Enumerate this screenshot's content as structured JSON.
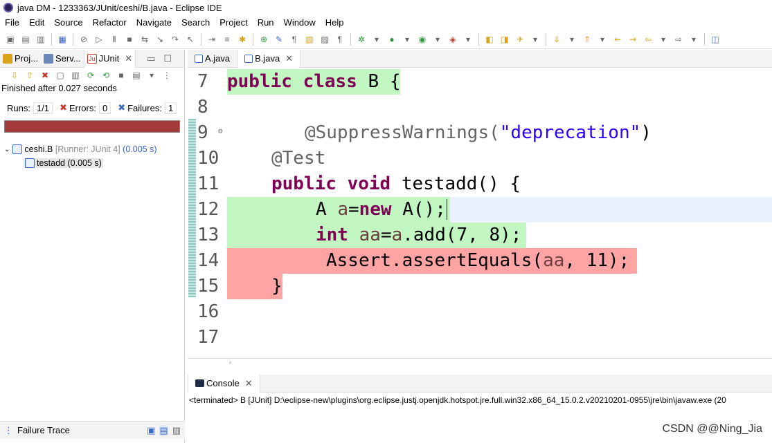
{
  "window": {
    "title": "java DM - 1233363/JUnit/ceshi/B.java - Eclipse IDE"
  },
  "menu": [
    "File",
    "Edit",
    "Source",
    "Refactor",
    "Navigate",
    "Search",
    "Project",
    "Run",
    "Window",
    "Help"
  ],
  "left_tabs": [
    {
      "label": "Proj..."
    },
    {
      "label": "Serv..."
    },
    {
      "label": "JUnit"
    }
  ],
  "junit": {
    "finished": "Finished after 0.027 seconds",
    "runs_label": "Runs:",
    "runs": "1/1",
    "errors_label": "Errors:",
    "errors": "0",
    "failures_label": "Failures:",
    "failures": "1",
    "status_color": "#a33a3a",
    "suite": {
      "name": "ceshi.B",
      "runner": "[Runner: JUnit 4]",
      "time": "(0.005 s)"
    },
    "test": {
      "name": "testadd (0.005 s)"
    }
  },
  "failure_trace": "Failure Trace",
  "editor_tabs": [
    {
      "label": "A.java"
    },
    {
      "label": "B.java"
    }
  ],
  "code_lines": {
    "7": "7",
    "8": "8",
    "9": "9",
    "10": "10",
    "11": "11",
    "12": "12",
    "13": "13",
    "14": "14",
    "15": "15",
    "16": "16",
    "17": "17"
  },
  "code": {
    "l7_kw1": "public",
    "l7_kw2": "class",
    "l7_rest": " B {",
    "l9_ann": "@SuppressWarnings(",
    "l9_str": "\"deprecation\"",
    "l9_end": ")",
    "l10_ann": "@Test",
    "l11_kw1": "public",
    "l11_kw2": "void",
    "l11_rest": " testadd() {",
    "l12_a": "A ",
    "l12_var": "a",
    "l12_eq": "=",
    "l12_new": "new",
    "l12_rest": " A();",
    "l13_int": "int",
    "l13_var": "aa",
    "l13_eq": "=",
    "l13_var2": "a",
    "l13_rest": ".add(7, 8);",
    "l14_a": "Assert.assertEquals(",
    "l14_var": "aa",
    "l14_rest": ", 11);",
    "l15": "}"
  },
  "console": {
    "tab": "Console",
    "line": "<terminated> B [JUnit] D:\\eclipse-new\\plugins\\org.eclipse.justj.openjdk.hotspot.jre.full.win32.x86_64_15.0.2.v20210201-0955\\jre\\bin\\javaw.exe  (20"
  },
  "watermark": "CSDN @@Ning_Jia"
}
